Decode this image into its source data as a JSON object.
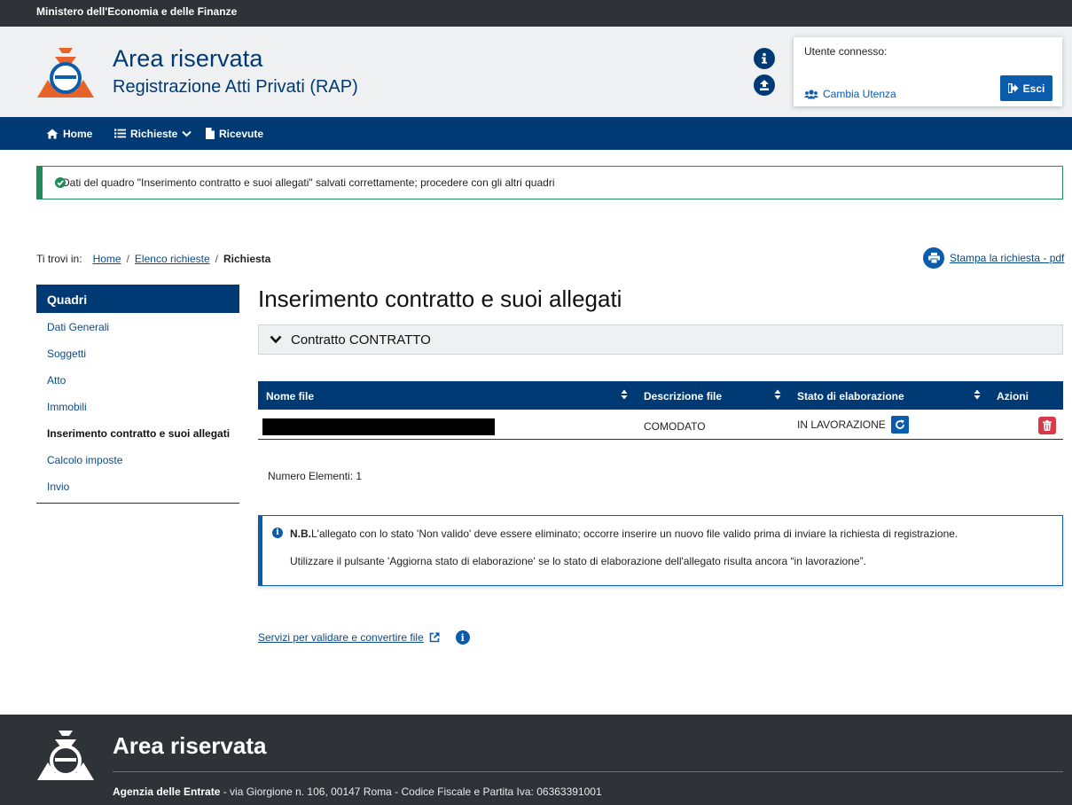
{
  "top_bar": {
    "ministry": "Ministero dell'Economia e delle Finanze"
  },
  "header": {
    "title": "Area riservata",
    "subtitle": "Registrazione Atti Privati (RAP)",
    "user_box": {
      "label": "Utente connesso:",
      "switch_user": "Cambia Utenza",
      "logout": "Esci"
    }
  },
  "nav": {
    "home": "Home",
    "richieste": "Richieste",
    "ricevute": "Ricevute"
  },
  "alert": {
    "message": "Dati del quadro \"Inserimento contratto e suoi allegati\" salvati correttamente; procedere con gli altri quadri"
  },
  "breadcrumb": {
    "prefix": "Ti trovi in:",
    "items": [
      "Home",
      "Elenco richieste"
    ],
    "current": "Richiesta"
  },
  "print_link": "Stampa la richiesta - pdf",
  "sidebar": {
    "heading": "Quadri",
    "items": [
      {
        "label": "Dati Generali"
      },
      {
        "label": "Soggetti"
      },
      {
        "label": "Atto"
      },
      {
        "label": "Immobili"
      },
      {
        "label": "Inserimento contratto e suoi allegati"
      },
      {
        "label": "Calcolo imposte"
      },
      {
        "label": "Invio"
      }
    ],
    "active_index": 4
  },
  "main": {
    "title": "Inserimento contratto e suoi allegati",
    "accordion": "Contratto CONTRATTO",
    "table": {
      "columns": [
        "Nome file",
        "Descrizione file",
        "Stato di elaborazione",
        "Azioni"
      ],
      "rows": [
        {
          "file_name": "",
          "description": "COMODATO",
          "status": "IN LAVORAZIONE"
        }
      ]
    },
    "count": "Numero Elementi: 1",
    "note": {
      "bold": "N.B.",
      "line1": "L'allegato con lo stato 'Non valido' deve essere eliminato; occorre inserire un nuovo file valido prima di inviare la richiesta di registrazione.",
      "line2": "Utilizzare il pulsante 'Aggiorna stato di elaborazione' se lo stato di elaborazione dell'allegato risulta ancora “in lavorazione”."
    },
    "services_link": "Servizi per validare e convertire file"
  },
  "footer": {
    "title": "Area riservata",
    "agency": "Agenzia delle Entrate",
    "address": " - via Giorgione n. 106, 00147 Roma - Codice Fiscale e Partita Iva: 06363391001"
  },
  "colors": {
    "primary": "#003a75",
    "accent": "#0b5cad",
    "success": "#1f8a5b",
    "danger": "#d9394a",
    "dark": "#2f3338",
    "logo_orange": "#e8632a"
  },
  "icons": [
    "agenzia-logo",
    "info-icon",
    "upload-icon",
    "users-icon",
    "logout-icon",
    "home-icon",
    "list-icon",
    "chevron-down-icon",
    "document-icon",
    "check-circle-icon",
    "print-icon",
    "sort-icon",
    "refresh-icon",
    "trash-icon",
    "external-link-icon"
  ]
}
